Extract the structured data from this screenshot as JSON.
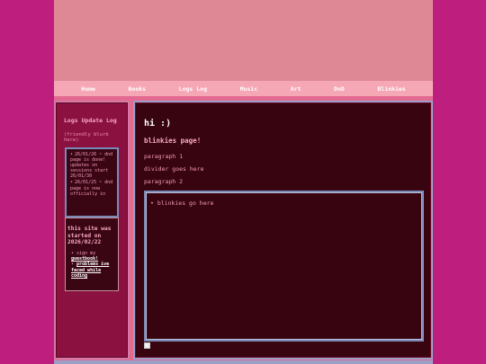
{
  "nav": {
    "items": [
      "Home",
      "Books",
      "Logs Log",
      "Music",
      "Art",
      "DnD",
      "Blinkies"
    ]
  },
  "sidebar": {
    "title": "Logs Update Log",
    "blurb": "(friendly blurb here)",
    "log_entries": [
      "26/01/26 ~ dnd page is done! updates on sessions start 26/01/30",
      "26/01/25 ~ dnd page is now officially in"
    ],
    "started": "this site was started on 2026/02/22",
    "links": [
      {
        "prefix": "sign my ",
        "label": "guestbook!"
      },
      {
        "prefix": "",
        "label": "problems ive faced while coding"
      }
    ]
  },
  "main": {
    "title": "hi :)",
    "subtitle": "blinkies page!",
    "paragraph1": "paragraph 1",
    "divider": "divider goes here",
    "paragraph2": "paragraph 2",
    "blinkies_placeholder": "blinkies go here"
  },
  "colors": {
    "page_bg": "#be1f7e",
    "banner": "#de8896",
    "nav_bar": "#f6a7b6",
    "panel_bg": "#38040f",
    "accent_text": "#f8a8c4",
    "border": "#9aa0c8"
  }
}
